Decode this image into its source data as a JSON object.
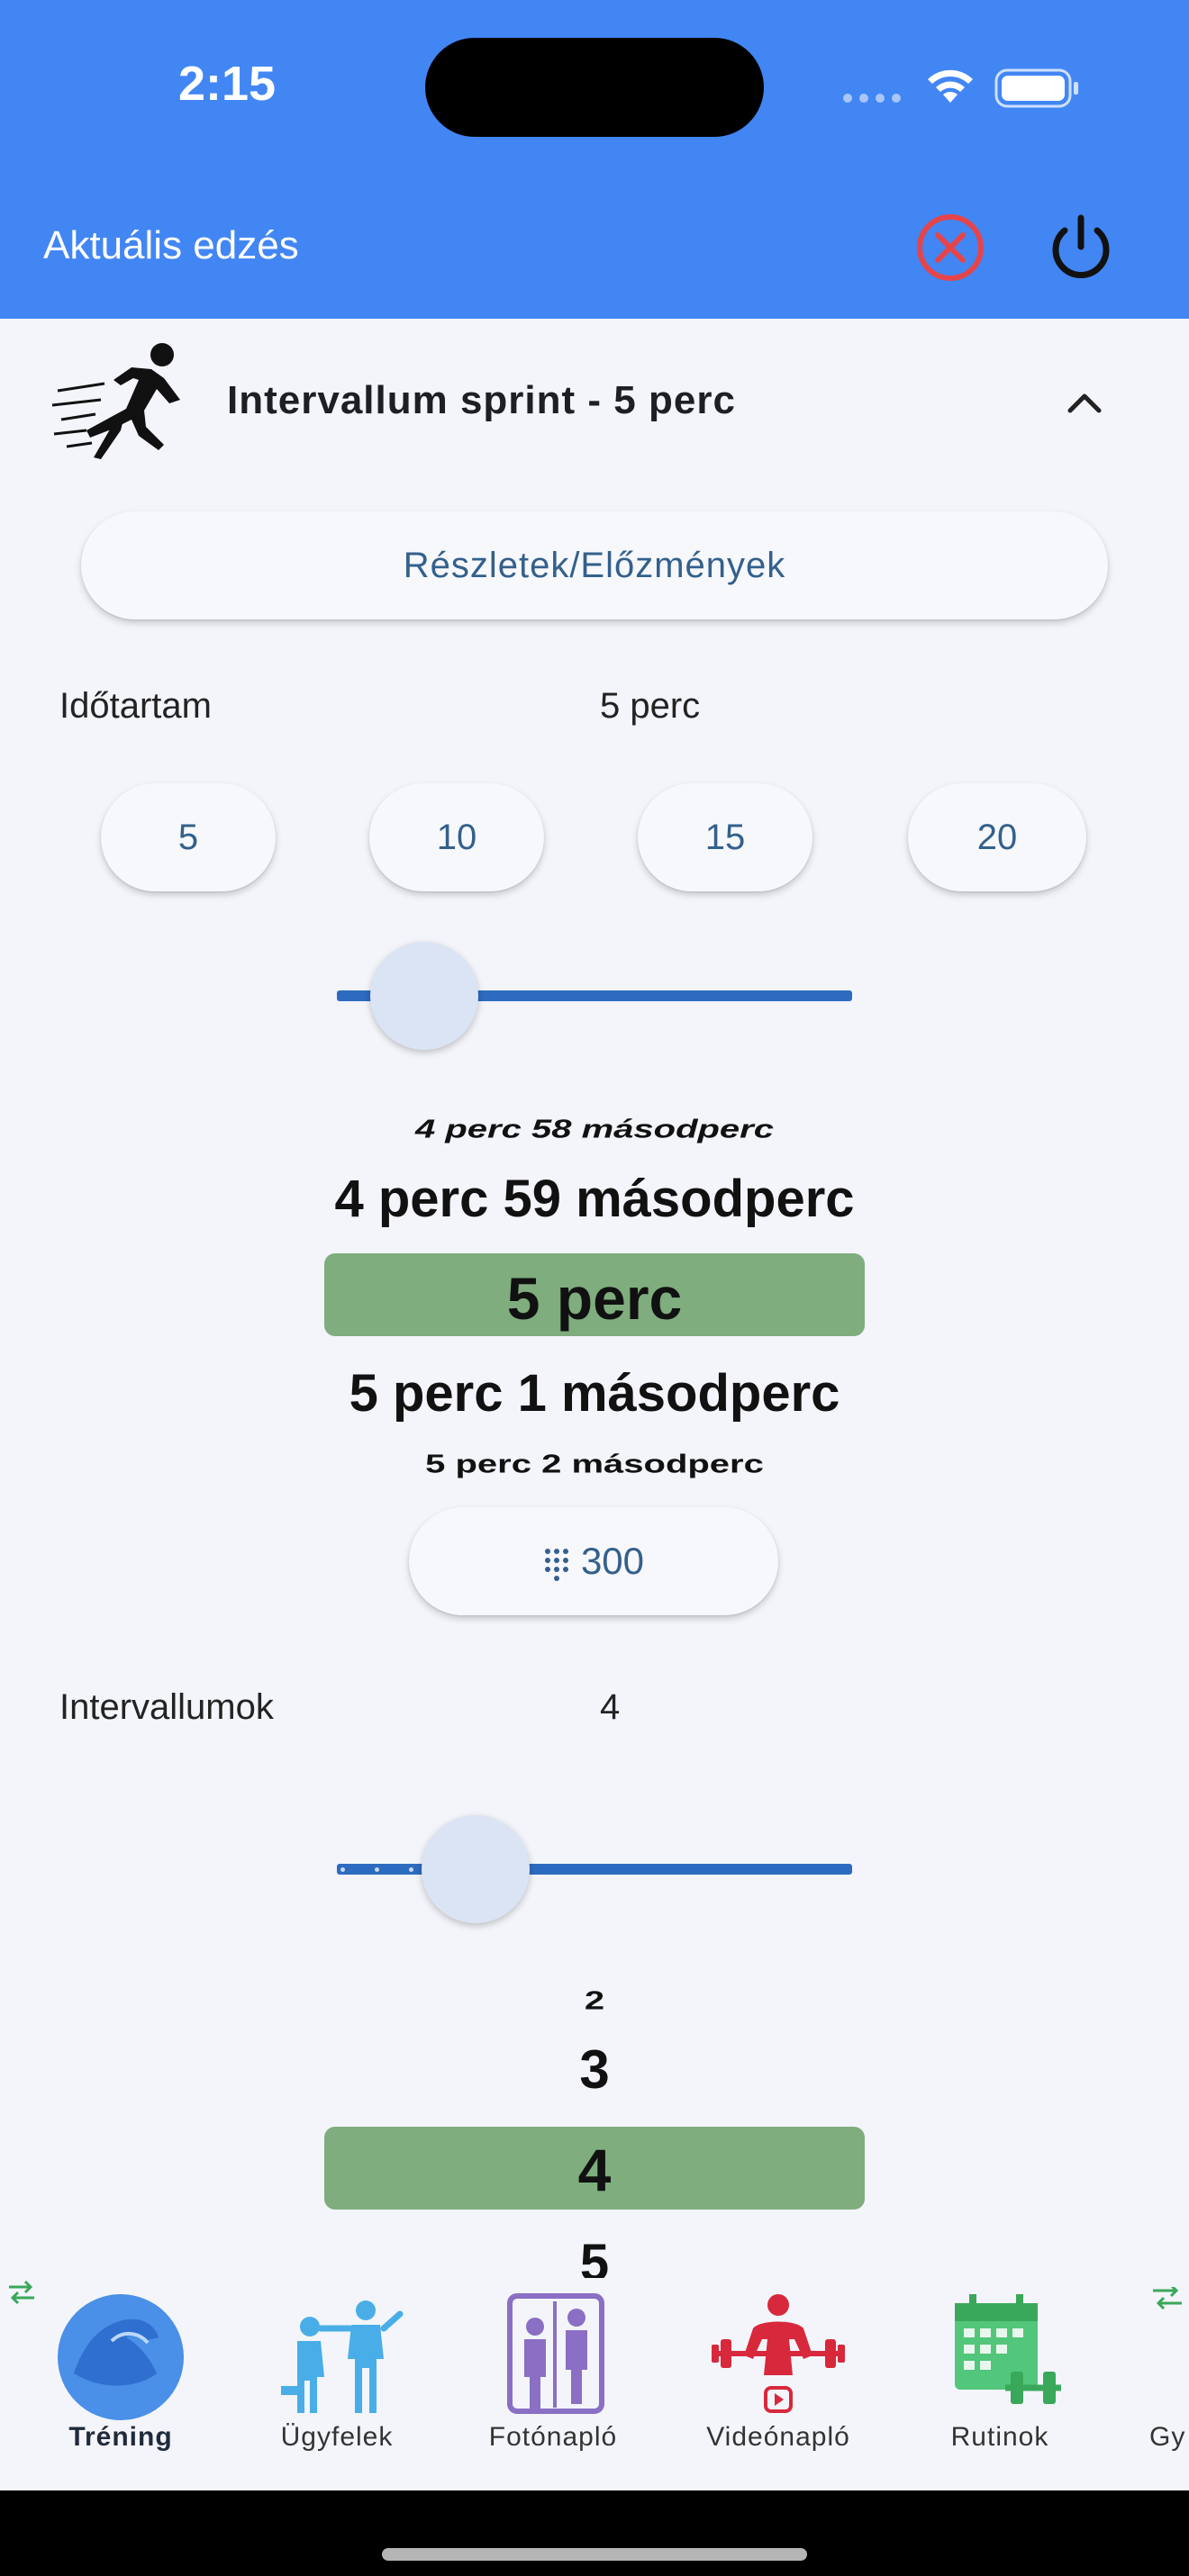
{
  "status_bar": {
    "time": "2:15"
  },
  "header": {
    "title": "Aktuális edzés",
    "cancel_icon": "close-circle-icon",
    "power_icon": "power-icon",
    "colors": {
      "background": "#4286f4",
      "cancel": "#e5454a"
    }
  },
  "exercise": {
    "title": "Intervallum sprint - 5 perc",
    "icon": "sprinter-icon",
    "details_label": "Részletek/Előzmények"
  },
  "duration": {
    "label": "Időtartam",
    "value": "5 perc",
    "presets": [
      "5",
      "10",
      "15",
      "20"
    ],
    "slider_fraction": 0.17,
    "picker": {
      "items": [
        "4 perc 58 másodperc",
        "4 perc 59 másodperc",
        "5 perc",
        "5 perc 1 másodperc",
        "5 perc 2 másodperc"
      ],
      "selected_index": 2
    },
    "seconds_button": "300"
  },
  "intervals": {
    "label": "Intervallumok",
    "value": "4",
    "slider_fraction": 0.27,
    "picker": {
      "items": [
        "2",
        "3",
        "4",
        "5"
      ],
      "selected_index": 2
    }
  },
  "nav": {
    "items": [
      {
        "label": "Tréning",
        "icon": "flexed-arm-icon",
        "active": true
      },
      {
        "label": "Ügyfelek",
        "icon": "clients-icon",
        "active": false
      },
      {
        "label": "Fotónapló",
        "icon": "photo-diary-icon",
        "active": false
      },
      {
        "label": "Videónapló",
        "icon": "video-diary-icon",
        "active": false
      },
      {
        "label": "Rutinok",
        "icon": "routines-calendar-icon",
        "active": false
      },
      {
        "label": "Gy",
        "icon": "swap-icon",
        "active": false
      }
    ],
    "colors": {
      "accent": "#4a8fe8",
      "clients": "#49aee8",
      "photo": "#8a6fc4",
      "video": "#d8283c",
      "routines": "#52c67a"
    }
  }
}
